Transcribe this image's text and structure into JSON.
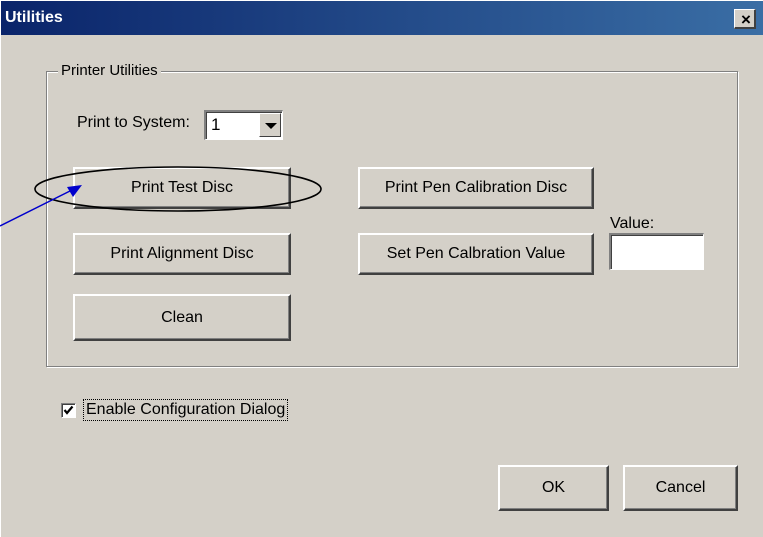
{
  "window": {
    "title": "Utilities",
    "close_label": "×"
  },
  "group": {
    "legend": "Printer Utilities"
  },
  "print_to_system": {
    "label": "Print to System:",
    "value": "1"
  },
  "buttons": {
    "print_test_disc": "Print Test Disc",
    "print_alignment_disc": "Print Alignment Disc",
    "clean": "Clean",
    "print_pen_calibration_disc": "Print Pen Calibration Disc",
    "set_pen_calibration_value": "Set Pen Calbration Value"
  },
  "value_field": {
    "label": "Value:",
    "value": ""
  },
  "enable_config": {
    "label": "Enable Configuration Dialog",
    "checked": true
  },
  "footer": {
    "ok": "OK",
    "cancel": "Cancel"
  },
  "annotation": {
    "stroke_color": "#000000",
    "arrow_color": "#0000cc"
  }
}
